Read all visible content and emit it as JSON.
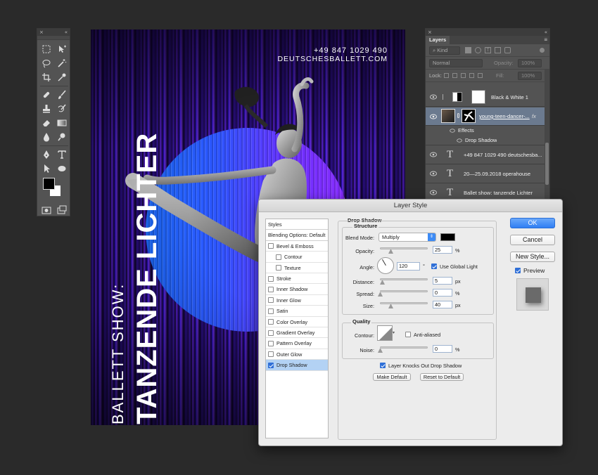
{
  "toolbar": {
    "collapse_glyph": "«",
    "close_glyph": "×"
  },
  "toolbar_icons": [
    "marquee-icon",
    "move-icon",
    "lasso-icon",
    "magic-wand-icon",
    "crop-icon",
    "eyedropper-icon",
    "healing-icon",
    "brush-icon",
    "stamp-icon",
    "history-brush-icon",
    "eraser-icon",
    "gradient-icon",
    "blur-icon",
    "dodge-icon",
    "pen-icon",
    "type-icon",
    "path-select-icon",
    "shape-icon",
    "hand-icon",
    "zoom-icon"
  ],
  "colors": {
    "foreground": "#000000",
    "background": "#ffffff",
    "poster_accent": "#5a22d6",
    "circle_start": "#1c6cff",
    "circle_end": "#8a2cff",
    "selection": "#b3d2f4",
    "ok_blue": "#3d8bf5"
  },
  "poster": {
    "phone": "+49 847 1029 490",
    "website": "DEUTSCHESBALLETT.COM",
    "subtitle": "BALLETT SHOW:",
    "title": "TANZENDE LICHTER"
  },
  "layers": {
    "title": "Layers",
    "menu_glyph": "≡",
    "kind_label": "Kind",
    "blend_mode": "Normal",
    "opacity_label": "Opacity:",
    "opacity_value": "100%",
    "lock_label": "Lock:",
    "fill_label": "Fill:",
    "fill_value": "100%",
    "items": [
      {
        "name": "Black & White 1"
      },
      {
        "name": "young-teen-dancer-..."
      },
      {
        "name": "Effects"
      },
      {
        "name": "Drop Shadow"
      },
      {
        "name": "+49 847 1029 490 deutschesba..."
      },
      {
        "name": "20—25.09.2018 operahouse"
      },
      {
        "name": "Ballet show: tanzende Lichter"
      }
    ],
    "fx_label": "fx"
  },
  "dialog": {
    "title": "Layer Style",
    "styles_header": "Styles",
    "blending_header": "Blending Options: Default",
    "style_items": [
      {
        "label": "Bevel & Emboss",
        "checked": false
      },
      {
        "label": "Contour",
        "checked": false
      },
      {
        "label": "Texture",
        "checked": false
      },
      {
        "label": "Stroke",
        "checked": false
      },
      {
        "label": "Inner Shadow",
        "checked": false
      },
      {
        "label": "Inner Glow",
        "checked": false
      },
      {
        "label": "Satin",
        "checked": false
      },
      {
        "label": "Color Overlay",
        "checked": false
      },
      {
        "label": "Gradient Overlay",
        "checked": false
      },
      {
        "label": "Pattern Overlay",
        "checked": false
      },
      {
        "label": "Outer Glow",
        "checked": false
      },
      {
        "label": "Drop Shadow",
        "checked": true
      }
    ],
    "section_title": "Drop Shadow",
    "structure_title": "Structure",
    "blend_mode_label": "Blend Mode:",
    "blend_mode_value": "Multiply",
    "opacity_label": "Opacity:",
    "opacity_value": "25",
    "percent": "%",
    "angle_label": "Angle:",
    "angle_value": "120",
    "degree": "°",
    "use_global_light": "Use Global Light",
    "distance_label": "Distance:",
    "distance_value": "5",
    "spread_label": "Spread:",
    "spread_value": "0",
    "size_label": "Size:",
    "size_value": "40",
    "px": "px",
    "quality_title": "Quality",
    "contour_label": "Contour:",
    "anti_aliased": "Anti-aliased",
    "noise_label": "Noise:",
    "noise_value": "0",
    "knocks_out": "Layer Knocks Out Drop Shadow",
    "make_default": "Make Default",
    "reset_default": "Reset to Default",
    "ok": "OK",
    "cancel": "Cancel",
    "new_style": "New Style...",
    "preview": "Preview"
  }
}
